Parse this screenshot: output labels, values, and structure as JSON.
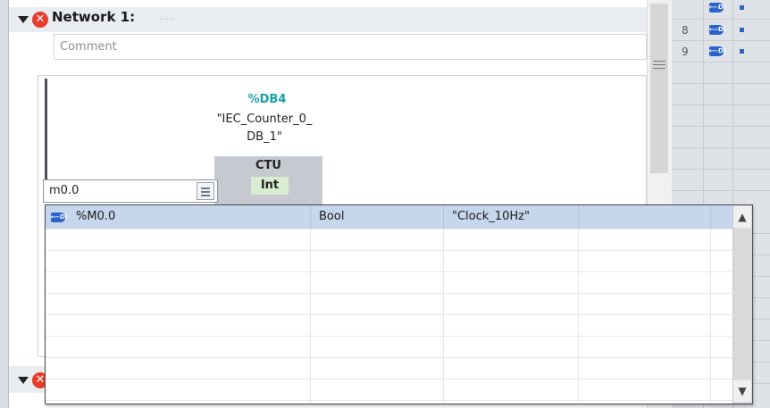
{
  "network1": {
    "title": "Network 1:",
    "title_field": ".....",
    "comment_placeholder": "Comment"
  },
  "block": {
    "db_name": "%DB4",
    "db_comment_line1": "\"IEC_Counter_0_",
    "db_comment_line2": "DB_1\"",
    "instruction": "CTU",
    "data_type": "Int"
  },
  "operand_input": {
    "value": "m0.0"
  },
  "dropdown": {
    "rows": [
      {
        "address": "%M0.0",
        "type": "Bool",
        "name": "\"Clock_10Hz\"",
        "extra": ""
      }
    ]
  },
  "side_panel": {
    "rows": [
      {
        "number": "8",
        "tag_icon": "tag-icon"
      },
      {
        "number": "9",
        "tag_icon": "tag-icon"
      }
    ]
  },
  "icons": {
    "error": "error-icon",
    "collapse": "triangle-down-icon",
    "list": "list-icon",
    "scroll_up": "▲",
    "scroll_down": "▼",
    "tag_text": "⟵DI"
  },
  "colors": {
    "error": "#e53c2e",
    "db_name": "#1aa0a8",
    "selection": "#c6d6ec",
    "tag": "#2b63c8",
    "block_fill": "#c6cad0",
    "type_fill": "#d8ecd0"
  }
}
